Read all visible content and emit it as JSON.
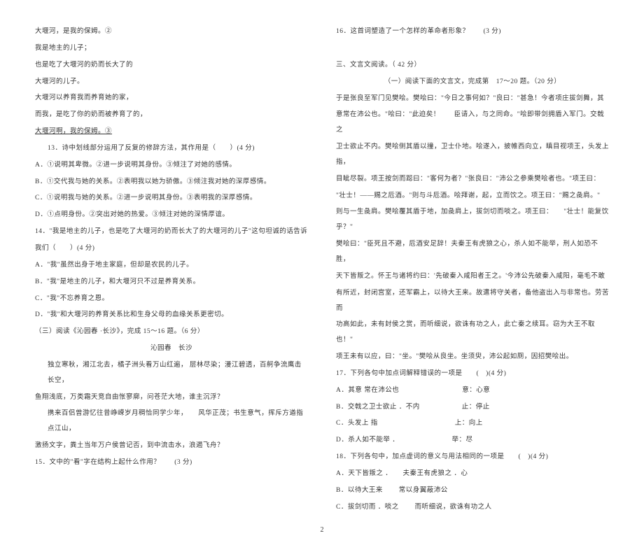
{
  "left": {
    "l1": "大堰河，是我的保姆。②",
    "l2": "我是地主的儿子；",
    "l3": "也是吃了大堰河的奶而长大了的",
    "l4": "大堰河的儿子。",
    "l5": "大堰河以养育我而养育她的家，",
    "l6": "而我，是吃了你的奶而被养育了的，",
    "l7": "大堰河啊，我的保姆。③",
    "q13": "13．诗中划线部分运用了反复的修辞方法，其作用是（　　）(4 分)",
    "q13a": "A．①说明其卑微。②进一步说明其身份。③倾注了对她的感情。",
    "q13b": "B．①交代我与她的关系。②表明我以她为骄傲。③倾注我对她的深厚感情。",
    "q13c": "C．①说明我与她的关系。②进一步说明其身份。③表明我的深厚感情。",
    "q13d": "D．①点明身份。②突出对她的热爱。③倾注对她的深情厚谊。",
    "q14": "14．\"我是地主的儿子，也是吃了大堰河的奶而长大了的大堰河的儿子\"这句坦诚的话告诉",
    "q14b": "我们（　　）(4 分)",
    "q14A": "A．\"我\"虽然出身于地主家庭，但却是农民的儿子。",
    "q14B": "B．\"我\"是地主的儿子，和大堰河只不过是养育关系。",
    "q14C": "C．\"我\"不忘养育之恩。",
    "q14D": "D．\"我\"和大堰河的养育关系比和生身父母的血缘关系更密切。",
    "sec3": "（三）阅读《沁园春 ·长沙》，完成 15～16 题。（6 分）",
    "poemTitle": "沁园春　长沙",
    "poem1": "独立寒秋，湘江北去，橘子洲头看万山红遍，  层林尽染；漫江碧透，百舸争流鹰击长空，",
    "poem2": "鱼翔浅底，万类霜天竞自由怅寥廓，问苍茫大地，谁主沉浮？",
    "poem3": "携来百侣曾游忆往昔峥嵘岁月稠恰同学少年，　　风华正茂；书生意气，挥斥方遒指点江山，",
    "poem4": "激扬文字，粪土当年万户侯曾记否，到中流击水，浪遏飞舟？",
    "q15": "15．文中的\"看\"字在结构上起什么作用？　　(3 分)"
  },
  "right": {
    "q16": "16．这首词塑造了一个怎样的革命者形象？　　(3 分)",
    "sec3h": "三、文言文阅读。（  42 分）",
    "sec3s": "（一）阅读下面的文言文，完成第　17～20 题。（20 分）",
    "p1": "于是张良至军门见樊哙。樊哙曰：\"今日之事何如？\"良曰：\"甚急！今者项庄拔剑舞，其",
    "p2": "意常在沛公也。\"哙曰：\"此迫矣！　　臣请入，与之同命。\"哙即带剑拥盾入军门。交戟之",
    "p3": "卫士欲止不内。樊哙侧其盾以撞，卫士仆地。哙遂入，披帷西向立，瞋目视项王，头发上指，",
    "p4": "目眦尽裂。项王按剑而跽曰：\"客何为者？\"张良曰：\"沛公之参乘樊哙者也。\"项王曰：",
    "p5": "\"壮士！——赐之卮酒。\"则与斗卮酒。哙拜谢，起，立而饮之。项王曰：\"赐之彘肩。\"",
    "p6": "则与一生彘肩。樊哙覆其盾于地，加彘肩上，拔剑切而啖之。项王曰：　　\"壮士！能复饮乎？\"",
    "p7": "樊哙曰：\"臣死且不避，卮酒安足辞！夫秦王有虎狼之心，杀人如不能举，刑人如恐不胜，",
    "p8": "天下皆叛之。怀王与诸将约曰：'先破秦入咸阳者王之。'今沛公先破秦入咸阳，毫毛不敢",
    "p9": "有所近，封闭宫室，还军霸上，以待大王来。故遣将守关者，备他盗出入与非常也。劳苦而",
    "p10": "功高如此，未有封侯之赏，而听细说，欲诛有功之人，此亡秦之续耳。窃为大王不取也！\"",
    "p11": "项王未有以应，曰：\"坐。\"樊哙从良坐。坐须臾，沛公起如厕，因招樊哙出。",
    "q17": "17．下列各句中加点词解释错误的一项是　　(　)(4 分)",
    "q17a": "A．其意 常在沛公也　　　　　　　　　意：心意",
    "q17b": "B．交戟之卫士欲止 ．不内　　　　　　止：停止",
    "q17c": "C．头发上 指　　　　　　　　　　　上：向上",
    "q17d": "D．杀人如不能举 ．　　　　　　　　举：尽",
    "q18": "18．下列各句中，加点虚词的意义与用法相同的一项是　　(　)(4 分)",
    "q18a": "A．天下皆叛之 ．　　夫秦王有虎狼之 ．心",
    "q18b": "B．以待大王来 　　常以身翼蔽沛公",
    "q18c": "C．拔剑切而 ．啖之 　　而听细说，欲诛有功之人"
  },
  "pageNum": "2"
}
